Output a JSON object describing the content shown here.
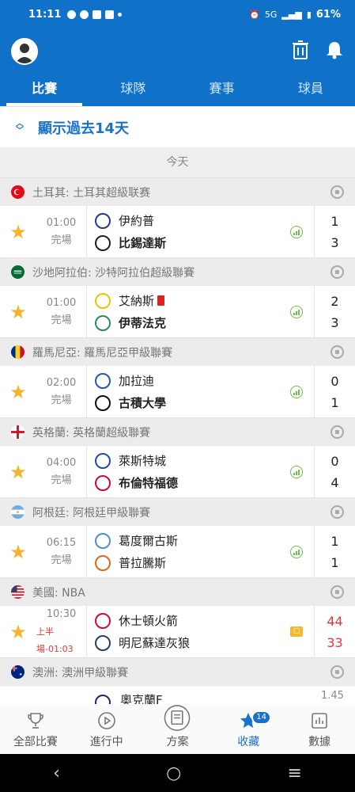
{
  "status": {
    "time": "11:11",
    "network": "5G",
    "battery": "61%"
  },
  "tabs": [
    "比賽",
    "球隊",
    "賽事",
    "球員"
  ],
  "show_past": "顯示過去14天",
  "today": "今天",
  "groups": [
    {
      "league": "土耳其: 土耳其超級联赛",
      "flag": "turkey",
      "sport": "soccer-ball-icon",
      "match": {
        "time": "01:00",
        "status": "完場",
        "home": "伊約普",
        "away": "比錫達斯",
        "home_score": "1",
        "away_score": "3",
        "winner": "away"
      }
    },
    {
      "league": "沙地阿拉伯: 沙特阿拉伯超級聯賽",
      "flag": "saudi",
      "sport": "soccer-ball-icon",
      "match": {
        "time": "01:00",
        "status": "完場",
        "home": "艾納斯",
        "away": "伊蒂法克",
        "home_score": "2",
        "away_score": "3",
        "winner": "away",
        "home_red_card": true
      }
    },
    {
      "league": "羅馬尼亞: 羅馬尼亞甲級聯賽",
      "flag": "romania",
      "sport": "soccer-ball-icon",
      "match": {
        "time": "02:00",
        "status": "完場",
        "home": "加拉迪",
        "away": "古積大學",
        "home_score": "0",
        "away_score": "1",
        "winner": "away"
      }
    },
    {
      "league": "英格蘭: 英格蘭超級聯賽",
      "flag": "england",
      "sport": "soccer-ball-icon",
      "match": {
        "time": "04:00",
        "status": "完場",
        "home": "萊斯特城",
        "away": "布倫特福德",
        "home_score": "0",
        "away_score": "4",
        "winner": "away"
      }
    },
    {
      "league": "阿根廷: 阿根廷甲級聯賽",
      "flag": "argentina",
      "sport": "soccer-ball-icon",
      "match": {
        "time": "06:15",
        "status": "完場",
        "home": "葛度爾古斯",
        "away": "普拉騰斯",
        "home_score": "1",
        "away_score": "1",
        "winner": "none"
      }
    },
    {
      "league": "美國: NBA",
      "flag": "usa",
      "sport": "basketball-icon",
      "match": {
        "time": "10:30",
        "status": "上半場-01:03",
        "home": "休士頓火箭",
        "away": "明尼蘇達灰狼",
        "home_score": "44",
        "away_score": "33",
        "winner": "live"
      }
    },
    {
      "league": "澳洲: 澳洲甲級聯賽",
      "flag": "australia",
      "sport": "soccer-ball-icon",
      "partial": {
        "home": "奧克蘭F",
        "odds": "1.45"
      }
    }
  ],
  "bottom_nav": [
    {
      "label": "全部比賽",
      "icon": "trophy-icon"
    },
    {
      "label": "進行中",
      "icon": "play-icon"
    },
    {
      "label": "方案",
      "icon": "document-icon"
    },
    {
      "label": "收藏",
      "icon": "star-icon",
      "badge": "14",
      "active": true
    },
    {
      "label": "數據",
      "icon": "chart-icon"
    }
  ],
  "colors": {
    "primary": "#0f72c8",
    "star": "#f6b32b",
    "live": "#d93b3b"
  }
}
